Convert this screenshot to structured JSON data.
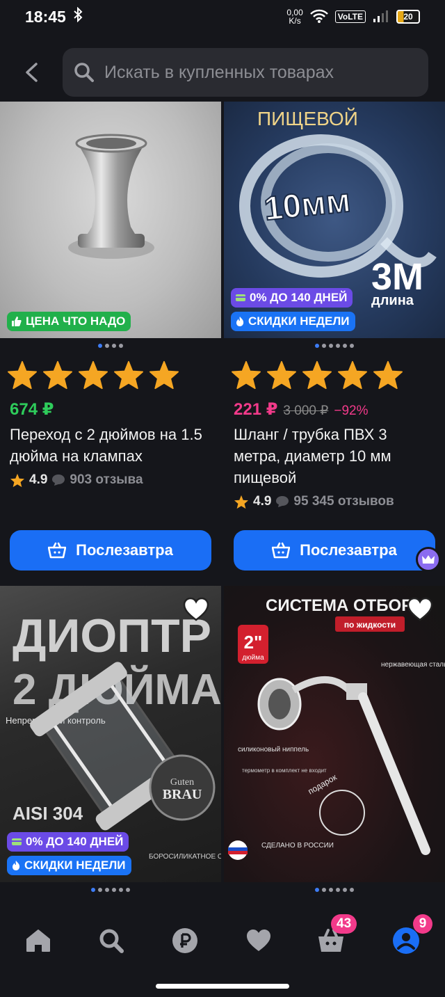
{
  "status_bar": {
    "time": "18:45",
    "net_speed_value": "0,00",
    "net_speed_unit": "K/s",
    "volte": "VoLTE",
    "battery": "20"
  },
  "search": {
    "placeholder": "Искать в купленных товарах"
  },
  "products": [
    {
      "badges": [
        "ЦЕНА ЧТО НАДО"
      ],
      "price": "674 ₽",
      "title": "Переход с 2 дюймов на 1.5 дюйма на клампах",
      "rating": "4.9",
      "reviews": "903 отзыва",
      "button": "Послезавтра",
      "images": 4,
      "active_image": 1
    },
    {
      "image_text": [
        "ПИЩЕВОЙ",
        "10мм",
        "3М",
        "длина"
      ],
      "badges": [
        "0% ДО 140 ДНЕЙ",
        "СКИДКИ НЕДЕЛИ"
      ],
      "price": "221 ₽",
      "old_price": "3 000 ₽",
      "discount": "−92%",
      "title": "Шланг / трубка ПВХ 3 метра, диаметр 10 мм пищевой",
      "rating": "4.9",
      "reviews": "95 345 отзывов",
      "button": "Послезавтра",
      "images": 6,
      "active_image": 1
    },
    {
      "image_text": [
        "ДИОПТР",
        "2 ДЮЙМА",
        "Непрерывный контроль",
        "AISI 304",
        "Guten",
        "BRAU",
        "БОРОСИЛИКАТНОЕ СТЕКЛО"
      ],
      "badges": [
        "0% ДО 140 ДНЕЙ",
        "СКИДКИ НЕДЕЛИ"
      ],
      "images": 6,
      "active_image": 1
    },
    {
      "image_text": [
        "СИСТЕМА ОТБОРА",
        "по жидкости",
        "2\"",
        "дюйма",
        "нержавеющая сталь",
        "силиконовый ниппель",
        "термометр в комплект не входит",
        "подарок",
        "СДЕЛАНО В РОССИИ"
      ],
      "images": 6,
      "active_image": 1
    }
  ],
  "bottom_nav": {
    "cart_count": "43",
    "profile_count": "9"
  },
  "colors": {
    "background": "#15161b",
    "accent": "#1a6ef5",
    "price_green": "#2ecc5b",
    "price_pink": "#f23a8a",
    "star": "#f5a623"
  }
}
